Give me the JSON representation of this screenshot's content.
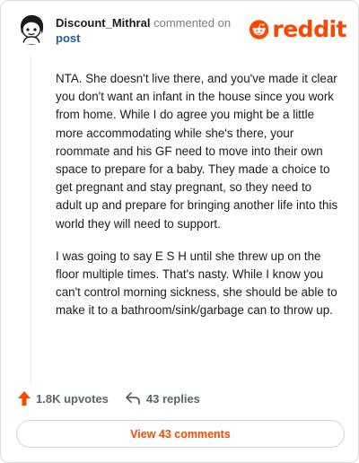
{
  "comment": {
    "author": "Discount_Mithral",
    "commented_text": "commented on",
    "post_link": "post",
    "paragraphs": [
      "NTA. She doesn't live there, and you've made it clear you don't want an infant in the house since you work from home. While I do agree you might be a little more accommodating while she's there, your roommate and his GF need to move into their own space to prepare for a baby. They made a choice to get pregnant and stay pregnant, so they need to adult up and prepare for bringing another life into this world they will need to support.",
      "I was going to say E S H until she threw up on the floor multiple times. That's nasty. While I know you can't control morning sickness, she should be able to make it to a bathroom/sink/garbage can to throw up."
    ]
  },
  "brand": {
    "wordmark": "reddit",
    "color": "#ff4500"
  },
  "actions": {
    "upvotes": "1.8K upvotes",
    "replies": "43 replies"
  },
  "footer": {
    "view_comments": "View 43 comments"
  },
  "icons": {
    "avatar": "snoo-avatar",
    "logo": "reddit-snoo-icon",
    "upvote": "upvote-arrow-icon",
    "reply": "reply-arrow-icon"
  }
}
